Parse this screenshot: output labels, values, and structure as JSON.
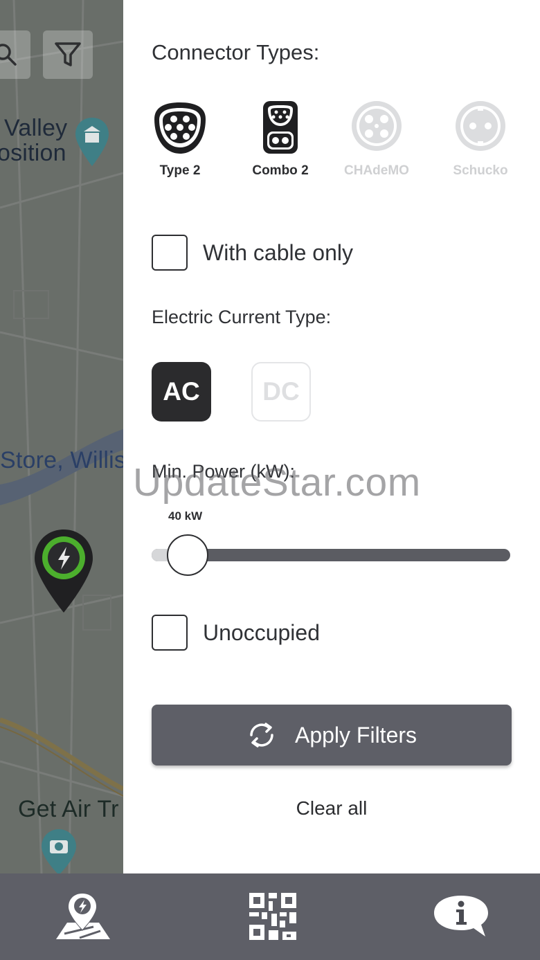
{
  "map": {
    "labels": [
      "Valley",
      "osition",
      "Store, Willis",
      "Get Air Tr"
    ]
  },
  "filters": {
    "connector_types_title": "Connector Types:",
    "connectors": [
      {
        "label": "Type 2",
        "selected": true
      },
      {
        "label": "Combo 2",
        "selected": true
      },
      {
        "label": "CHAdeMO",
        "selected": false
      },
      {
        "label": "Schucko",
        "selected": false
      }
    ],
    "with_cable_label": "With cable only",
    "with_cable_checked": false,
    "current_type_title": "Electric Current Type:",
    "current_types": [
      {
        "label": "AC",
        "selected": true
      },
      {
        "label": "DC",
        "selected": false
      }
    ],
    "min_power_title": "Min. Power (kW):",
    "min_power_value_label": "40 kW",
    "min_power_level_fraction": 0.1,
    "unoccupied_label": "Unoccupied",
    "unoccupied_checked": false,
    "apply_label": "Apply Filters",
    "clear_label": "Clear all"
  },
  "watermark": "UpdateStar.com",
  "bottom_nav": [
    {
      "icon": "map-charger-icon"
    },
    {
      "icon": "qr-code-icon"
    },
    {
      "icon": "info-chat-icon"
    }
  ],
  "colors": {
    "accent_dark": "#2b2b2d",
    "button_gray": "#5e5f67",
    "disabled": "#cfd0d2",
    "pin_green": "#4caf2d"
  }
}
